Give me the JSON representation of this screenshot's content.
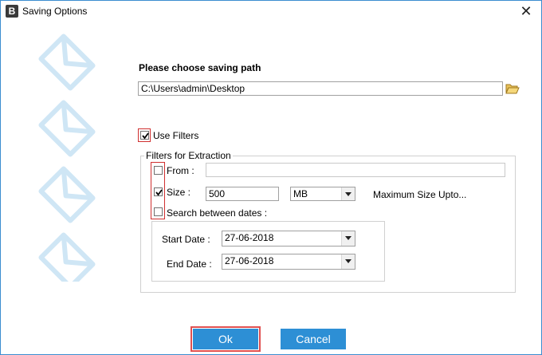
{
  "window": {
    "title": "Saving Options",
    "app_icon_letter": "B",
    "close_glyph": "✕"
  },
  "path": {
    "heading": "Please choose saving path",
    "value": "C:\\Users\\admin\\Desktop",
    "browse_icon": "folder-open-icon"
  },
  "use_filters": {
    "label": "Use Filters",
    "checked": true
  },
  "filters": {
    "legend": "Filters for Extraction",
    "from": {
      "label": "From :",
      "checked": false,
      "value": ""
    },
    "size": {
      "label": "Size :",
      "checked": true,
      "value": "500",
      "unit": "MB",
      "hint": "Maximum Size Upto..."
    },
    "dates": {
      "label": "Search between dates :",
      "checked": false,
      "start_label": "Start Date :",
      "start_value": "27-06-2018",
      "end_label": "End Date :",
      "end_value": "27-06-2018"
    }
  },
  "buttons": {
    "ok": "Ok",
    "cancel": "Cancel"
  },
  "colors": {
    "accent": "#2d8fd5",
    "highlight": "#d03030",
    "envelope": "#cfe6f5"
  }
}
